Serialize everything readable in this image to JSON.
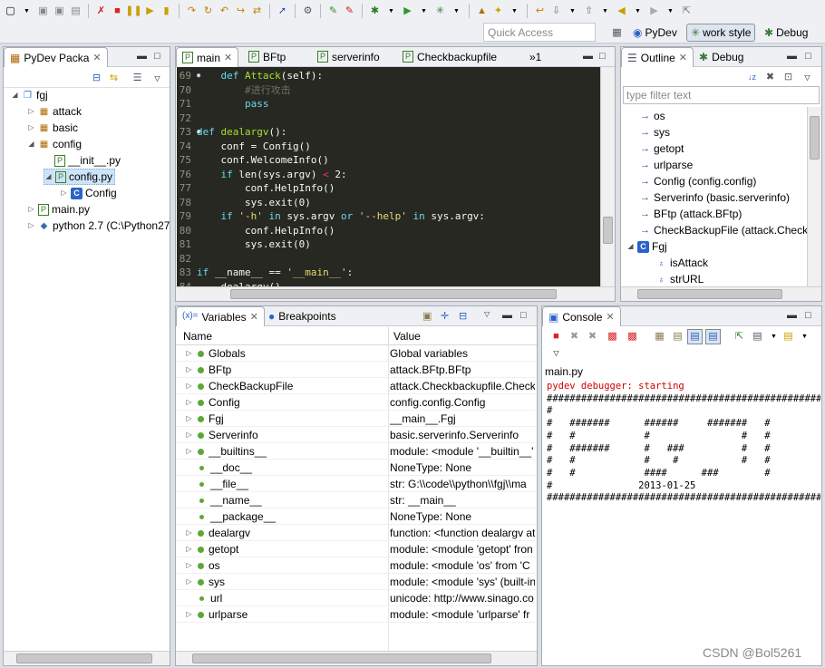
{
  "toolbar": {
    "quick_access_placeholder": "Quick Access",
    "perspectives": [
      "PyDev",
      "work style",
      "Debug"
    ]
  },
  "package_explorer": {
    "tab_label": "PyDev Packa",
    "items": [
      {
        "label": "fgj",
        "icon": "project-folder-icon"
      },
      {
        "label": "attack",
        "icon": "package-icon"
      },
      {
        "label": "basic",
        "icon": "package-icon"
      },
      {
        "label": "config",
        "icon": "package-icon"
      },
      {
        "label": "__init__.py",
        "icon": "python-file-icon"
      },
      {
        "label": "config.py",
        "icon": "python-file-icon"
      },
      {
        "label": "Config",
        "icon": "class-icon"
      },
      {
        "label": "main.py",
        "icon": "python-file-icon"
      },
      {
        "label": "python 2.7  (C:\\Python27",
        "icon": "python-interpreter-icon"
      }
    ]
  },
  "editor": {
    "tabs": [
      "main",
      "BFtp",
      "serverinfo",
      "Checkbackupfile",
      "»1"
    ],
    "lines": [
      {
        "n": "69",
        "tokens": [
          [
            "tx",
            "    "
          ],
          [
            "kw",
            "def "
          ],
          [
            "fn",
            "Attack"
          ],
          [
            "tx",
            "(self):"
          ]
        ]
      },
      {
        "n": "70",
        "tokens": [
          [
            "cm",
            "        #进行攻击"
          ]
        ]
      },
      {
        "n": "71",
        "tokens": [
          [
            "kw",
            "        pass"
          ]
        ]
      },
      {
        "n": "72",
        "tokens": [
          [
            "tx",
            ""
          ]
        ]
      },
      {
        "n": "73",
        "tokens": [
          [
            "kw",
            "def "
          ],
          [
            "fn",
            "dealargv"
          ],
          [
            "tx",
            "():"
          ]
        ]
      },
      {
        "n": "74",
        "tokens": [
          [
            "tx",
            "    conf = Config()"
          ]
        ]
      },
      {
        "n": "75",
        "tokens": [
          [
            "tx",
            "    conf.WelcomeInfo()"
          ]
        ]
      },
      {
        "n": "76",
        "tokens": [
          [
            "kw",
            "    if "
          ],
          [
            "tx",
            "len(sys.argv) "
          ],
          [
            "op",
            "<"
          ],
          [
            "tx",
            " 2:"
          ]
        ]
      },
      {
        "n": "77",
        "tokens": [
          [
            "tx",
            "        conf.HelpInfo()"
          ]
        ]
      },
      {
        "n": "78",
        "tokens": [
          [
            "tx",
            "        sys.exit(0)"
          ]
        ]
      },
      {
        "n": "79",
        "tokens": [
          [
            "kw",
            "    if "
          ],
          [
            "st",
            "'-h'"
          ],
          [
            "kw",
            " in "
          ],
          [
            "tx",
            "sys.argv "
          ],
          [
            "kw",
            "or "
          ],
          [
            "st",
            "'--help'"
          ],
          [
            "kw",
            " in "
          ],
          [
            "tx",
            "sys.argv:"
          ]
        ]
      },
      {
        "n": "80",
        "tokens": [
          [
            "tx",
            "        conf.HelpInfo()"
          ]
        ]
      },
      {
        "n": "81",
        "tokens": [
          [
            "tx",
            "        sys.exit(0)"
          ]
        ]
      },
      {
        "n": "82",
        "tokens": [
          [
            "tx",
            ""
          ]
        ]
      },
      {
        "n": "83",
        "tokens": [
          [
            "kw",
            "if "
          ],
          [
            "tx",
            "__name__ == "
          ],
          [
            "st",
            "'__main__'"
          ],
          [
            "tx",
            ":"
          ]
        ]
      },
      {
        "n": "84",
        "tokens": [
          [
            "tx",
            "    dealargv()"
          ]
        ]
      }
    ]
  },
  "outline": {
    "tabs": [
      "Outline",
      "Debug"
    ],
    "filter_placeholder": "type filter text",
    "items": [
      {
        "label": "os",
        "icon": "import-icon"
      },
      {
        "label": "sys",
        "icon": "import-icon"
      },
      {
        "label": "getopt",
        "icon": "import-icon"
      },
      {
        "label": "urlparse",
        "icon": "import-icon"
      },
      {
        "label": "Config (config.config)",
        "icon": "import-icon"
      },
      {
        "label": "Serverinfo (basic.serverinfo)",
        "icon": "import-icon"
      },
      {
        "label": "BFtp (attack.BFtp)",
        "icon": "import-icon"
      },
      {
        "label": "CheckBackupFile (attack.Checkb",
        "icon": "import-icon"
      },
      {
        "label": "Fgj",
        "icon": "class-icon"
      },
      {
        "label": "isAttack",
        "icon": "attribute-icon"
      },
      {
        "label": "strURL",
        "icon": "attribute-icon"
      }
    ]
  },
  "variables": {
    "tabs": [
      "Variables",
      "Breakpoints"
    ],
    "columns": [
      "Name",
      "Value"
    ],
    "rows": [
      {
        "name": "Globals",
        "value": "Global variables",
        "expandable": true
      },
      {
        "name": "BFtp",
        "value": "attack.BFtp.BFtp",
        "expandable": true
      },
      {
        "name": "CheckBackupFile",
        "value": "attack.Checkbackupfile.CheckB",
        "expandable": true
      },
      {
        "name": "Config",
        "value": "config.config.Config",
        "expandable": true
      },
      {
        "name": "Fgj",
        "value": "__main__.Fgj",
        "expandable": true
      },
      {
        "name": "Serverinfo",
        "value": "basic.serverinfo.Serverinfo",
        "expandable": true
      },
      {
        "name": "__builtins__",
        "value": "module: <module '__builtin__' (",
        "expandable": true
      },
      {
        "name": "__doc__",
        "value": "NoneType: None",
        "expandable": false
      },
      {
        "name": "__file__",
        "value": "str: G:\\\\code\\\\python\\\\fgj\\\\ma",
        "expandable": false
      },
      {
        "name": "__name__",
        "value": "str: __main__",
        "expandable": false
      },
      {
        "name": "__package__",
        "value": "NoneType: None",
        "expandable": false
      },
      {
        "name": "dealargv",
        "value": "function: <function dealargv at",
        "expandable": true
      },
      {
        "name": "getopt",
        "value": "module: <module 'getopt' fron",
        "expandable": true
      },
      {
        "name": "os",
        "value": "module: <module 'os' from 'C",
        "expandable": true
      },
      {
        "name": "sys",
        "value": "module: <module 'sys' (built-in",
        "expandable": true
      },
      {
        "name": "url",
        "value": "unicode: http://www.sinago.co",
        "expandable": false
      },
      {
        "name": "urlparse",
        "value": "module: <module 'urlparse' fr",
        "expandable": true
      }
    ]
  },
  "console": {
    "tab_label": "Console",
    "process_label": "main.py",
    "lines": [
      {
        "text": "pydev debugger: starting",
        "color": "#d40000"
      },
      {
        "text": "########################################################",
        "color": "#000000"
      },
      {
        "text": "#                                                      #",
        "color": "#000000"
      },
      {
        "text": "#   #######      ######     #######   #",
        "color": "#000000"
      },
      {
        "text": "#   #            #                #   #",
        "color": "#000000"
      },
      {
        "text": "#   #######      #   ###          #   #",
        "color": "#000000"
      },
      {
        "text": "#   #            #    #           #   #",
        "color": "#000000"
      },
      {
        "text": "#   #            ####      ###        #",
        "color": "#000000"
      },
      {
        "text": "#               2013-01-25                             #",
        "color": "#000000"
      },
      {
        "text": "########################################################",
        "color": "#000000"
      }
    ]
  },
  "watermark": "CSDN @Bol5261",
  "colors": {
    "editor_bg": "#272822",
    "keyword": "#66d9ef",
    "function": "#a6e22e",
    "string": "#e6db74",
    "comment": "#75715e",
    "console_error": "#d40000"
  }
}
